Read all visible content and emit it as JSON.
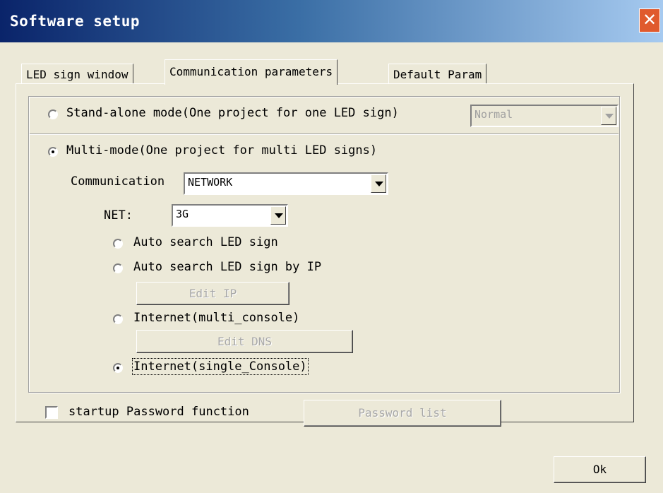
{
  "window": {
    "title": "Software setup",
    "close_glyph": "✕"
  },
  "tabs": [
    {
      "label": "LED sign window",
      "active": false
    },
    {
      "label": "Communication parameters",
      "active": true
    },
    {
      "label": "Default Param",
      "active": false
    }
  ],
  "standalone": {
    "label": "Stand-alone mode(One project for one LED sign)",
    "selected": false,
    "mode_value": "Normal"
  },
  "multimode": {
    "label": "Multi-mode(One project for multi LED signs)",
    "selected": true,
    "communication_label": "Communication",
    "communication_value": "NETWORK",
    "net_label": "NET:",
    "net_value": "3G",
    "options": [
      {
        "label": "Auto search LED sign",
        "selected": false
      },
      {
        "label": "Auto search LED sign by IP",
        "selected": false
      },
      {
        "label": "Internet(multi_console)",
        "selected": false
      },
      {
        "label": "Internet(single_Console)",
        "selected": true
      }
    ],
    "edit_ip_label": "Edit IP",
    "edit_dns_label": "Edit DNS"
  },
  "password": {
    "checkbox_label": "startup Password function",
    "checked": false,
    "list_button_label": "Password list"
  },
  "footer": {
    "ok_label": "Ok"
  },
  "colors": {
    "title_start": "#0a246a",
    "title_end": "#a6caf0",
    "face": "#ece9d8",
    "close": "#e05a2e"
  }
}
